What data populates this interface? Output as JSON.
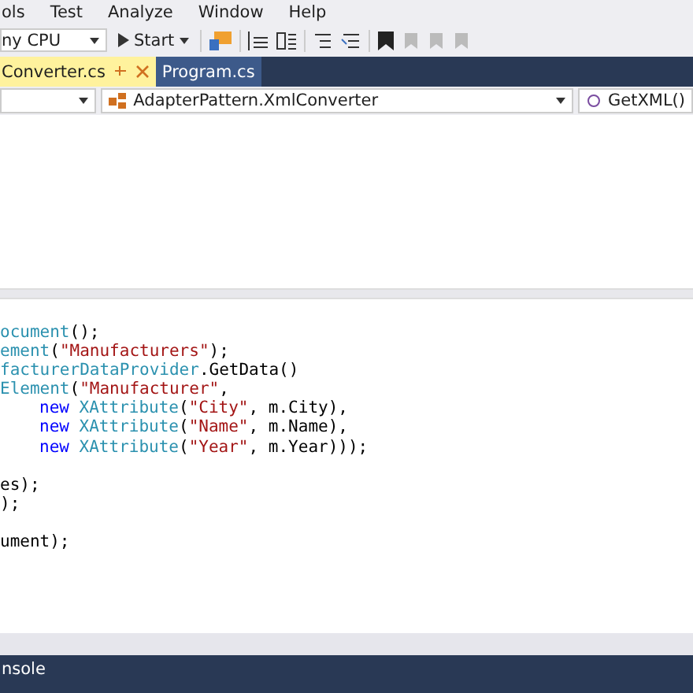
{
  "menu": [
    "ols",
    "Test",
    "Analyze",
    "Window",
    "Help"
  ],
  "toolbar": {
    "platform": "ny CPU",
    "start": "Start"
  },
  "tabs": [
    {
      "label": "Converter.cs",
      "selected": true
    },
    {
      "label": "Program.cs",
      "selected": false
    }
  ],
  "navbar": {
    "type": "AdapterPattern.XmlConverter",
    "member": "GetXML()"
  },
  "code": [
    {
      "tokens": [
        {
          "kind": "type",
          "text": "ocument"
        },
        {
          "kind": "plain",
          "text": "();"
        }
      ]
    },
    {
      "tokens": [
        {
          "kind": "type",
          "text": "ement"
        },
        {
          "kind": "plain",
          "text": "("
        },
        {
          "kind": "string",
          "text": "\"Manufacturers\""
        },
        {
          "kind": "plain",
          "text": ");"
        }
      ]
    },
    {
      "tokens": [
        {
          "kind": "type",
          "text": "facturerDataProvider"
        },
        {
          "kind": "plain",
          "text": ".GetData()"
        }
      ]
    },
    {
      "tokens": [
        {
          "kind": "type",
          "text": "Element"
        },
        {
          "kind": "plain",
          "text": "("
        },
        {
          "kind": "string",
          "text": "\"Manufacturer\""
        },
        {
          "kind": "plain",
          "text": ","
        }
      ]
    },
    {
      "indented": true,
      "tokens": [
        {
          "kind": "keyword",
          "text": "new"
        },
        {
          "kind": "type",
          "text": "XAttribute"
        },
        {
          "kind": "plain",
          "text": "("
        },
        {
          "kind": "string",
          "text": "\"City\""
        },
        {
          "kind": "plain",
          "text": ", m.City),"
        }
      ]
    },
    {
      "indented": true,
      "tokens": [
        {
          "kind": "keyword",
          "text": "new"
        },
        {
          "kind": "type",
          "text": "XAttribute"
        },
        {
          "kind": "plain",
          "text": "("
        },
        {
          "kind": "string",
          "text": "\"Name\""
        },
        {
          "kind": "plain",
          "text": ", m.Name),"
        }
      ]
    },
    {
      "indented": true,
      "tokens": [
        {
          "kind": "keyword",
          "text": "new"
        },
        {
          "kind": "type",
          "text": "XAttribute"
        },
        {
          "kind": "plain",
          "text": "("
        },
        {
          "kind": "string",
          "text": "\"Year\""
        },
        {
          "kind": "plain",
          "text": ", m.Year)));"
        }
      ]
    },
    {
      "blank_before": true,
      "tokens": [
        {
          "kind": "plain",
          "text": "es);"
        }
      ]
    },
    {
      "tokens": [
        {
          "kind": "plain",
          "text": ");"
        }
      ]
    },
    {
      "blank_before": true,
      "tokens": [
        {
          "kind": "plain",
          "text": "ument);"
        }
      ]
    }
  ],
  "bottom_tab": "nsole"
}
